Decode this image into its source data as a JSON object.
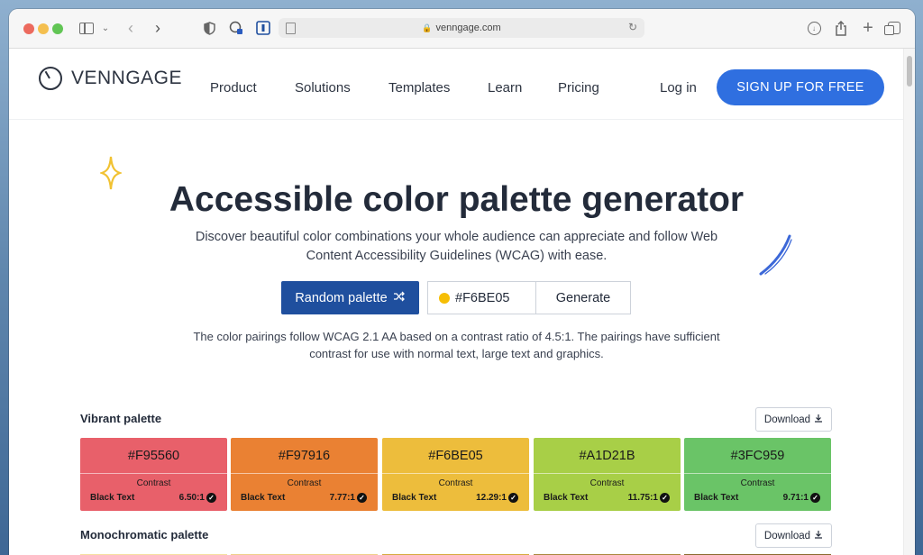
{
  "browser": {
    "url": "venngage.com",
    "icons": [
      "sidebar-icon",
      "chevron-down-icon",
      "back-icon",
      "forward-icon",
      "shield-icon",
      "extension-icon",
      "reader-icon",
      "download-icon",
      "share-icon",
      "new-tab-icon",
      "tabs-icon"
    ]
  },
  "site": {
    "logo_text": "VENNGAGE",
    "nav": [
      "Product",
      "Solutions",
      "Templates",
      "Learn",
      "Pricing"
    ],
    "login": "Log in",
    "signup": "SIGN UP FOR FREE"
  },
  "hero": {
    "title": "Accessible color palette generator",
    "subtitle": "Discover beautiful color combinations your whole audience can appreciate and follow Web Content Accessibility Guidelines (WCAG) with ease.",
    "random_button": "Random palette",
    "hex_value": "#F6BE05",
    "generate_button": "Generate",
    "note": "The color pairings follow WCAG 2.1 AA based on a contrast ratio of 4.5:1. The pairings have sufficient contrast for use with normal text, large text and graphics."
  },
  "vibrant": {
    "title": "Vibrant palette",
    "download": "Download",
    "swatches": [
      {
        "hex": "#F95560",
        "color": "#E8606A",
        "contrast": "Contrast",
        "text": "Black Text",
        "ratio": "6.50:1"
      },
      {
        "hex": "#F97916",
        "color": "#EA8133",
        "contrast": "Contrast",
        "text": "Black Text",
        "ratio": "7.77:1"
      },
      {
        "hex": "#F6BE05",
        "color": "#EDBD3C",
        "contrast": "Contrast",
        "text": "Black Text",
        "ratio": "12.29:1"
      },
      {
        "hex": "#A1D21B",
        "color": "#A8CF47",
        "contrast": "Contrast",
        "text": "Black Text",
        "ratio": "11.75:1"
      },
      {
        "hex": "#3FC959",
        "color": "#6AC467",
        "contrast": "Contrast",
        "text": "Black Text",
        "ratio": "9.71:1"
      }
    ]
  },
  "monochromatic": {
    "title": "Monochromatic palette",
    "download": "Download",
    "colors": [
      "#F6DFA0",
      "#F0D08A",
      "#D6AA3E",
      "#A9873D",
      "#8A6A2E"
    ]
  }
}
